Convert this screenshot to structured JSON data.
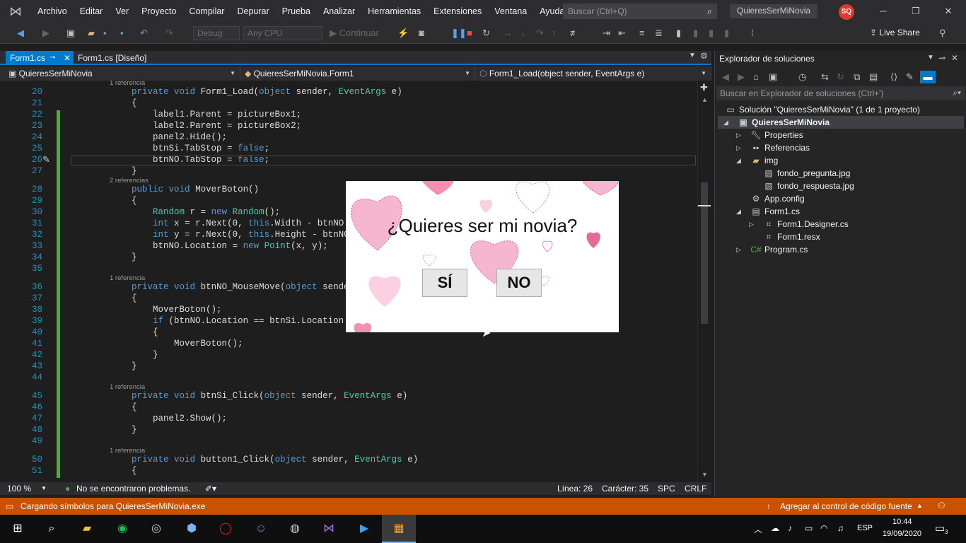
{
  "menu": {
    "items": [
      "Archivo",
      "Editar",
      "Ver",
      "Proyecto",
      "Compilar",
      "Depurar",
      "Prueba",
      "Analizar",
      "Herramientas",
      "Extensiones",
      "Ventana",
      "Ayuda"
    ],
    "search_placeholder": "Buscar (Ctrl+Q)",
    "solution_name": "QuieresSerMiNovia",
    "user_initials": "SQ"
  },
  "toolbar": {
    "config": "Debug",
    "platform": "Any CPU",
    "continue": "Continuar",
    "live_share": "Live Share"
  },
  "tabs": [
    "Form1.cs",
    "Form1.cs [Diseño]"
  ],
  "nav": {
    "project": "QuieresSerMiNovia",
    "class": "QuieresSerMiNovia.Form1",
    "member": "Form1_Load(object sender, EventArgs e)"
  },
  "code": {
    "refs": {
      "r1": "1 referencia",
      "r2": "2 referencias",
      "r3": "1 referencia",
      "r4": "1 referencia",
      "r5": "1 referencia"
    },
    "lines": [
      {
        "n": "20",
        "t": "        private void Form1_Load(object sender, EventArgs e)"
      },
      {
        "n": "21",
        "t": "        {"
      },
      {
        "n": "22",
        "t": "            label1.Parent = pictureBox1;"
      },
      {
        "n": "23",
        "t": "            label2.Parent = pictureBox2;"
      },
      {
        "n": "24",
        "t": "            panel2.Hide();"
      },
      {
        "n": "25",
        "t": "            btnSi.TabStop = false;"
      },
      {
        "n": "26",
        "t": "            btnNO.TabStop = false;"
      },
      {
        "n": "27",
        "t": "        }"
      },
      {
        "n": "28",
        "t": "        public void MoverBoton()"
      },
      {
        "n": "29",
        "t": "        {"
      },
      {
        "n": "30",
        "t": "            Random r = new Random();"
      },
      {
        "n": "31",
        "t": "            int x = r.Next(0, this.Width - btnNO.Width);"
      },
      {
        "n": "32",
        "t": "            int y = r.Next(0, this.Height - btnNO.Height"
      },
      {
        "n": "33",
        "t": "            btnNO.Location = new Point(x, y);"
      },
      {
        "n": "34",
        "t": "        }"
      },
      {
        "n": "35",
        "t": ""
      },
      {
        "n": "36",
        "t": "        private void btnNO_MouseMove(object sender, Mous"
      },
      {
        "n": "37",
        "t": "        {"
      },
      {
        "n": "38",
        "t": "            MoverBoton();"
      },
      {
        "n": "39",
        "t": "            if (btnNO.Location == btnSi.Location || btnN"
      },
      {
        "n": "40",
        "t": "            {"
      },
      {
        "n": "41",
        "t": "                MoverBoton();"
      },
      {
        "n": "42",
        "t": "            }"
      },
      {
        "n": "43",
        "t": "        }"
      },
      {
        "n": "44",
        "t": ""
      },
      {
        "n": "45",
        "t": "        private void btnSi_Click(object sender, EventArgs e)"
      },
      {
        "n": "46",
        "t": "        {"
      },
      {
        "n": "47",
        "t": "            panel2.Show();"
      },
      {
        "n": "48",
        "t": "        }"
      },
      {
        "n": "49",
        "t": ""
      },
      {
        "n": "50",
        "t": "        private void button1_Click(object sender, EventArgs e)"
      },
      {
        "n": "51",
        "t": "        {"
      }
    ]
  },
  "editor_status": {
    "zoom": "100 %",
    "issues": "No se encontraron problemas.",
    "line": "Línea: 26",
    "char": "Carácter: 35",
    "spc": "SPC",
    "crlf": "CRLF"
  },
  "solution_explorer": {
    "title": "Explorador de soluciones",
    "search": "Buscar en Explorador de soluciones (Ctrl+')",
    "items": [
      "Solución \"QuieresSerMiNovia\" (1 de 1 proyecto)",
      "QuieresSerMiNovia",
      "Properties",
      "Referencias",
      "img",
      "fondo_pregunta.jpg",
      "fondo_respuesta.jpg",
      "App.config",
      "Form1.cs",
      "Form1.Designer.cs",
      "Form1.resx",
      "Program.cs"
    ]
  },
  "statusbar": {
    "left": "Cargando símbolos para QuieresSerMiNovia.exe",
    "right": "Agregar al control de código fuente"
  },
  "taskbar": {
    "lang": "ESP",
    "time": "10:44",
    "date": "19/09/2020",
    "notif": "3"
  },
  "popup": {
    "question": "¿Quieres ser mi novia?",
    "yes": "SÍ",
    "no": "NO"
  },
  "colors": {
    "accent": "#007acc",
    "status": "#ca5100",
    "heart": "#f48fb1"
  }
}
